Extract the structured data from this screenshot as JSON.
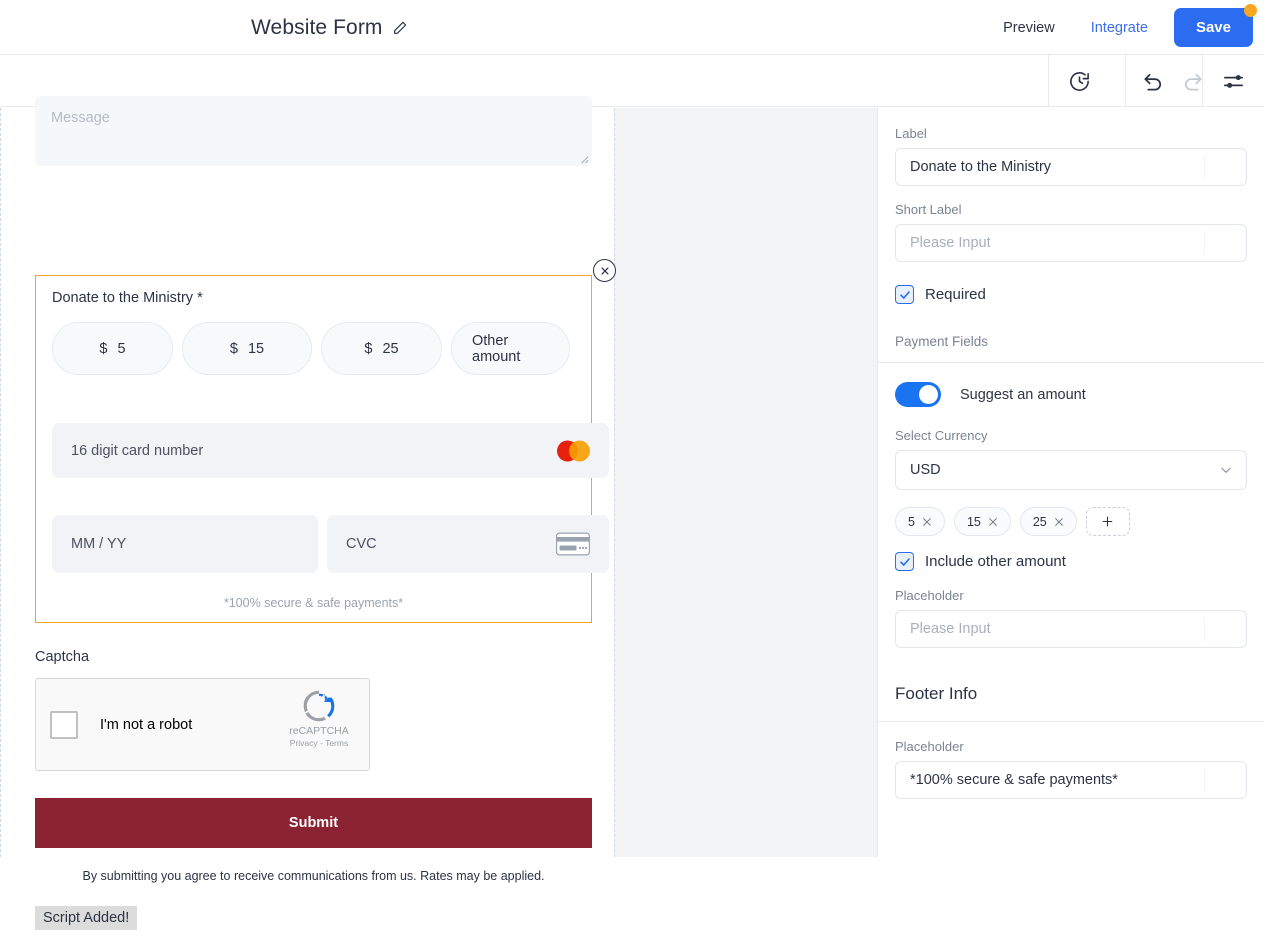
{
  "topbar": {
    "title": "Website Form",
    "edit_icon": "pencil-icon",
    "preview_label": "Preview",
    "integrate_label": "Integrate",
    "save_label": "Save",
    "save_badge_color": "#f5a623",
    "save_bg_color": "#2b6cf0"
  },
  "toolbar": {
    "history_icon": "clock-history-icon",
    "undo_icon": "undo-icon",
    "redo_icon": "redo-icon",
    "settings_icon": "sliders-settings-icon"
  },
  "form": {
    "message_placeholder": "Message",
    "donate_block": {
      "label": "Donate to the Ministry *",
      "close_icon": "close-circle-icon",
      "selected_outline_color": "#f0a32a",
      "amounts": [
        {
          "currency_symbol": "$",
          "value": "5"
        },
        {
          "currency_symbol": "$",
          "value": "15"
        },
        {
          "currency_symbol": "$",
          "value": "25"
        }
      ],
      "other_amount_label": "Other amount",
      "card_number_placeholder": "16 digit card number",
      "card_brand_icon": "mastercard-icon",
      "expiry_placeholder": "MM / YY",
      "cvc_placeholder": "CVC",
      "cvc_icon": "credit-card-icon",
      "footer_note": "*100% secure & safe payments*"
    },
    "captcha": {
      "label": "Captcha",
      "checkbox_label": "I'm not a robot",
      "brand": "reCAPTCHA",
      "terms": "Privacy - Terms",
      "logo_icon": "recaptcha-icon"
    },
    "submit_label": "Submit",
    "submit_color": "#8b2232",
    "terms_text": "By submitting you agree to receive communications from us. Rates may be applied.",
    "script_status": "Script Added!"
  },
  "sidebar": {
    "label_field": {
      "label": "Label",
      "value": "Donate to the Ministry"
    },
    "short_label_field": {
      "label": "Short Label",
      "placeholder": "Please Input"
    },
    "required": {
      "label": "Required",
      "checked": true,
      "check_icon": "check-icon"
    },
    "payment_fields_label": "Payment Fields",
    "suggest_amount": {
      "label": "Suggest an amount",
      "enabled": true,
      "accent": "#1a73f0"
    },
    "currency": {
      "label": "Select Currency",
      "value": "USD",
      "chevron_icon": "chevron-down-icon"
    },
    "amount_chips": [
      {
        "value": "5",
        "remove_icon": "close-x-icon"
      },
      {
        "value": "15",
        "remove_icon": "close-x-icon"
      },
      {
        "value": "25",
        "remove_icon": "close-x-icon"
      }
    ],
    "add_chip_icon": "plus-icon",
    "include_other_amount": {
      "label": "Include other amount",
      "checked": true,
      "check_icon": "check-icon"
    },
    "other_placeholder_field": {
      "label": "Placeholder",
      "placeholder": "Please Input"
    },
    "footer_info": {
      "heading": "Footer Info",
      "placeholder_label": "Placeholder",
      "placeholder_value": "*100% secure & safe payments*"
    }
  }
}
